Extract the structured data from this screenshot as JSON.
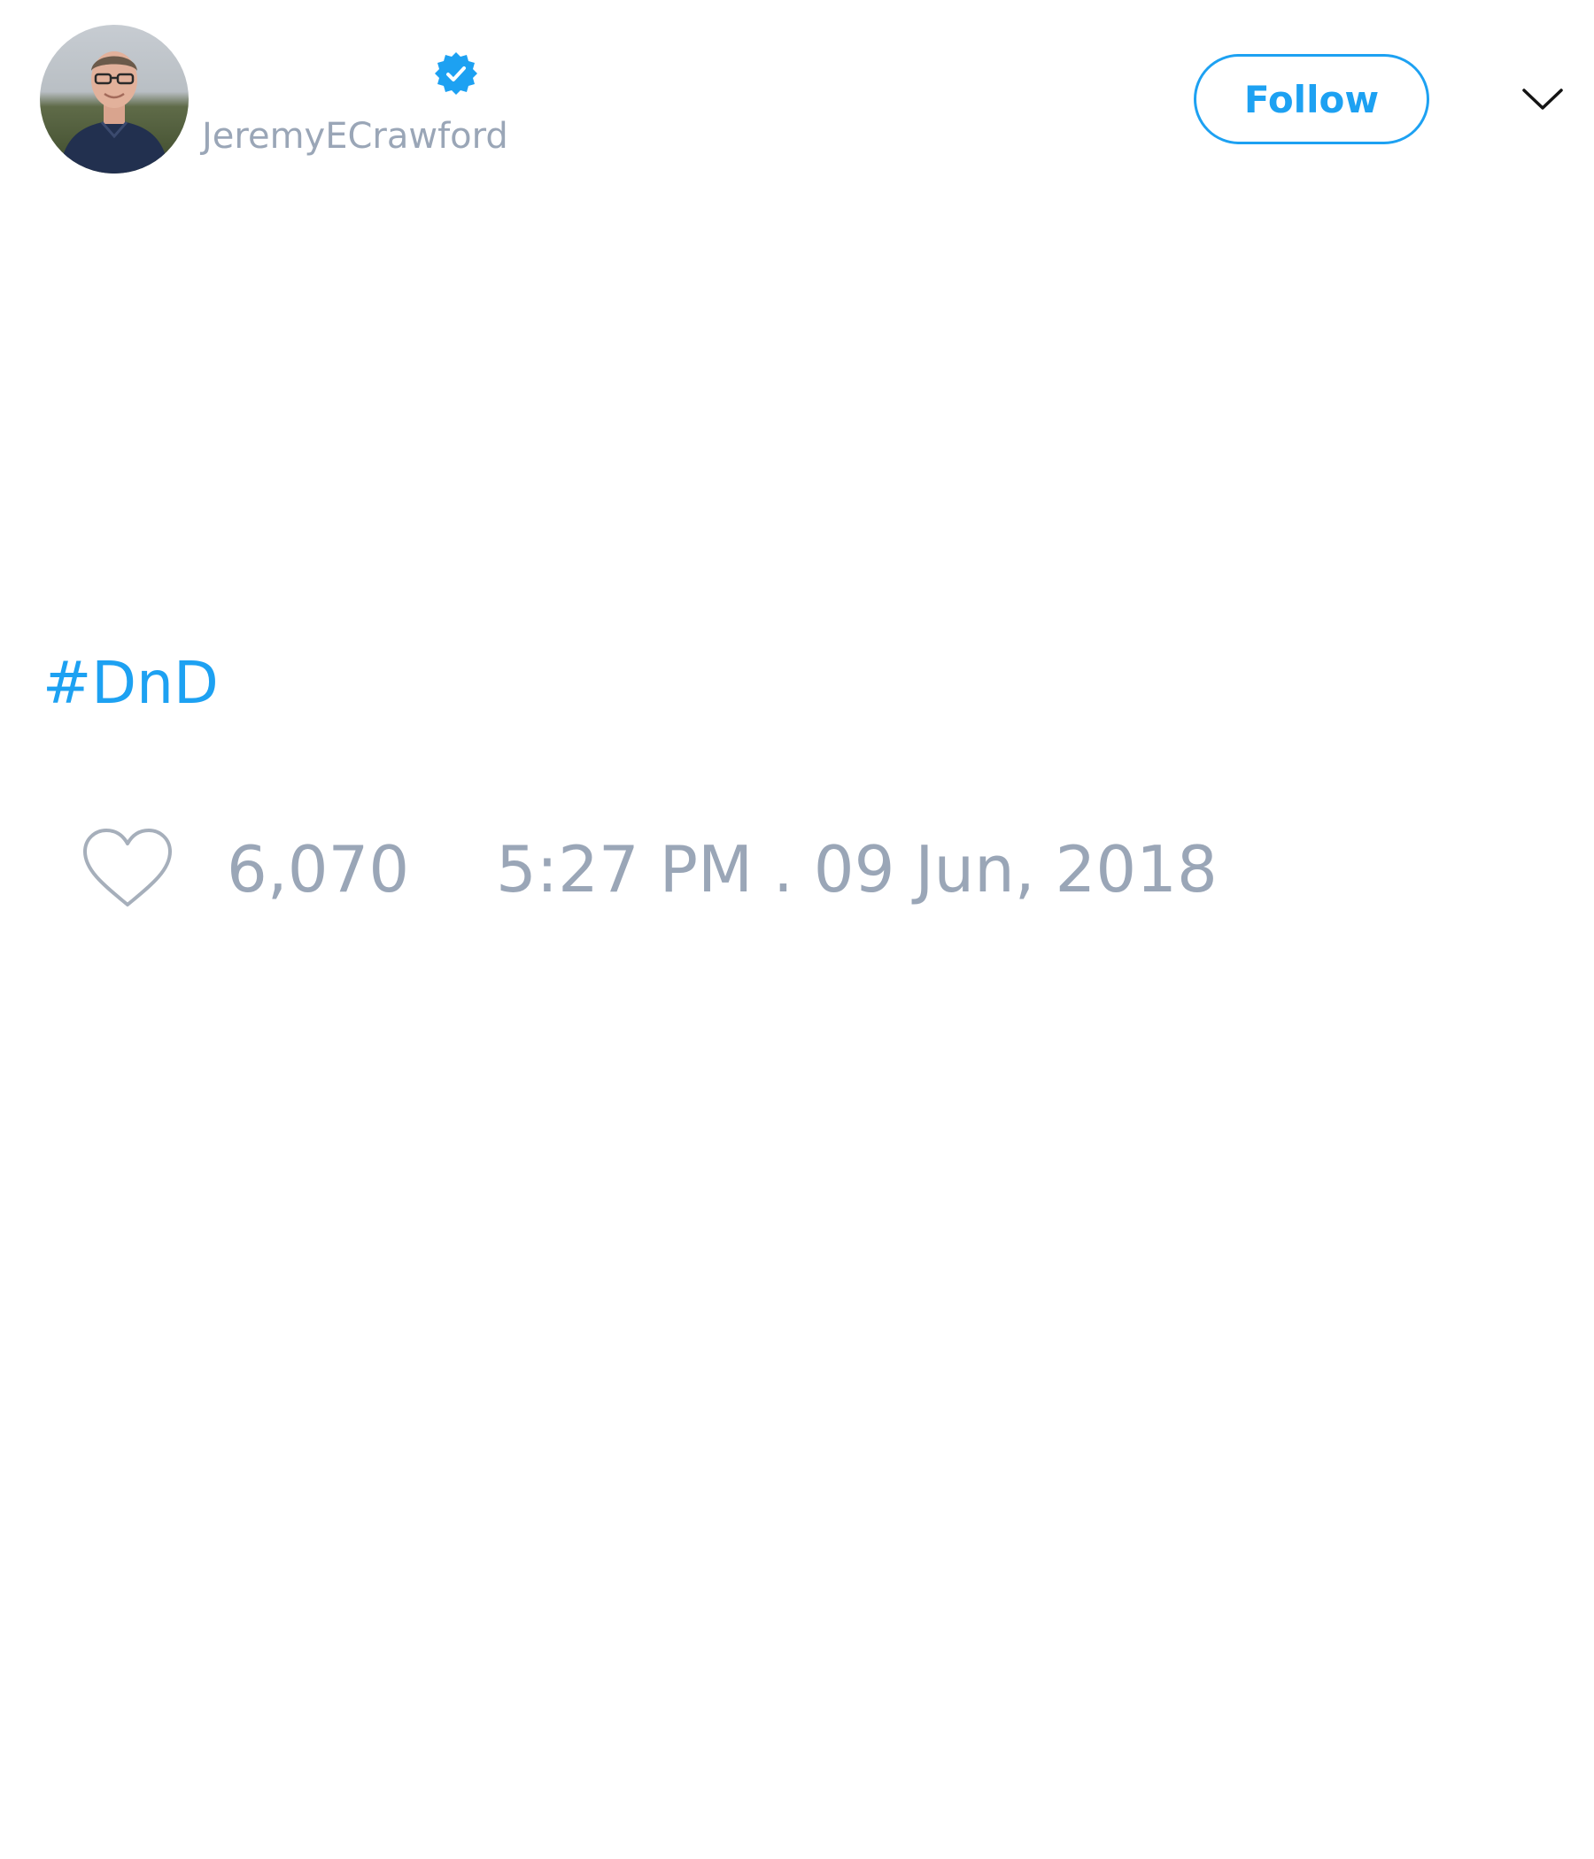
{
  "tweet": {
    "author": {
      "handle": "JeremyECrawford",
      "verified": true
    },
    "follow_label": "Follow",
    "text": {
      "hashtag": "#DnD"
    },
    "likes": "6,070",
    "timestamp": "5:27 PM . 09 Jun, 2018"
  },
  "icons": {
    "avatar": "profile-photo",
    "verified": "verified-badge-icon",
    "menu": "chevron-down-icon",
    "like": "heart-outline-icon"
  },
  "colors": {
    "accent": "#1da1f2",
    "muted_text": "#9aa6b7",
    "background": "#ffffff"
  }
}
